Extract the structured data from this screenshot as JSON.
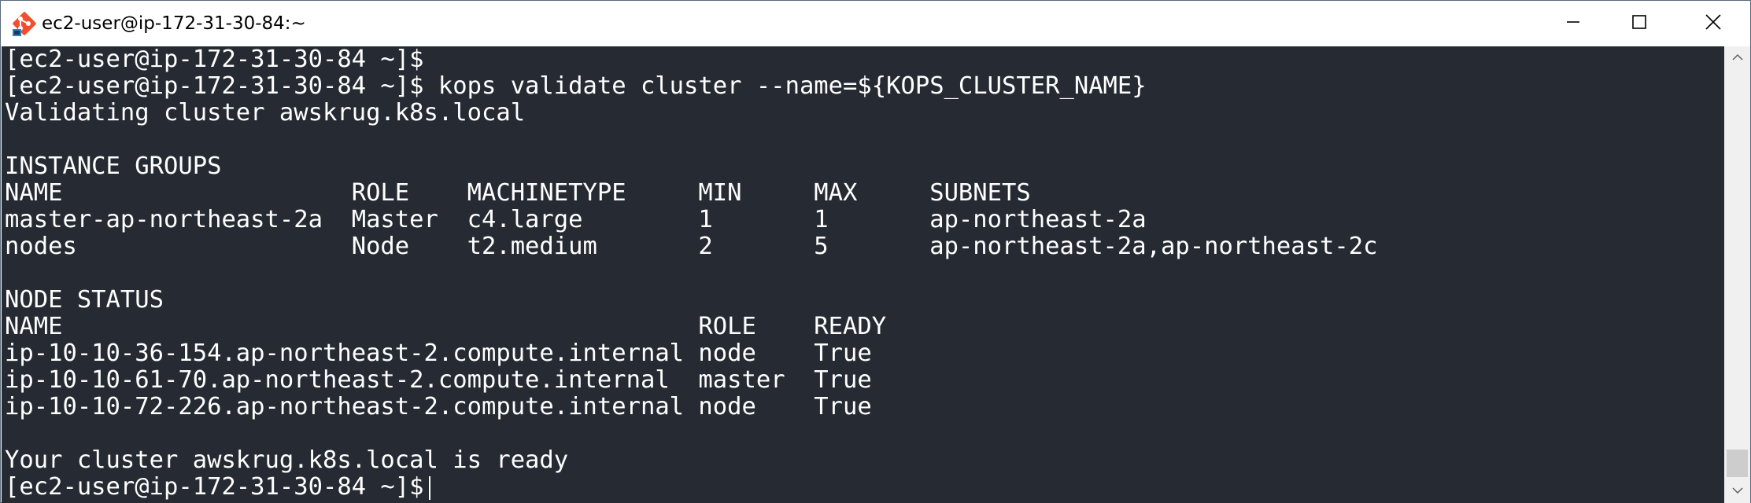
{
  "window": {
    "title": "ec2-user@ip-172-31-30-84:~",
    "app_icon": "git-bash-icon",
    "controls": {
      "minimize_icon": "minimize-icon",
      "maximize_icon": "maximize-icon",
      "close_icon": "close-icon"
    }
  },
  "terminal": {
    "background_color": "#262b33",
    "text_color": "#ffffff",
    "lines": [
      "[ec2-user@ip-172-31-30-84 ~]$",
      "[ec2-user@ip-172-31-30-84 ~]$ kops validate cluster --name=${KOPS_CLUSTER_NAME}",
      "Validating cluster awskrug.k8s.local",
      "",
      "INSTANCE GROUPS",
      "NAME                    ROLE    MACHINETYPE     MIN     MAX     SUBNETS",
      "master-ap-northeast-2a  Master  c4.large        1       1       ap-northeast-2a",
      "nodes                   Node    t2.medium       2       5       ap-northeast-2a,ap-northeast-2c",
      "",
      "NODE STATUS",
      "NAME                                            ROLE    READY",
      "ip-10-10-36-154.ap-northeast-2.compute.internal node    True",
      "ip-10-10-61-70.ap-northeast-2.compute.internal  master  True",
      "ip-10-10-72-226.ap-northeast-2.compute.internal node    True",
      "",
      "Your cluster awskrug.k8s.local is ready",
      "[ec2-user@ip-172-31-30-84 ~]$"
    ]
  },
  "scrollbar": {
    "up_icon": "scroll-up-arrow-icon",
    "down_icon": "scroll-down-arrow-icon"
  }
}
